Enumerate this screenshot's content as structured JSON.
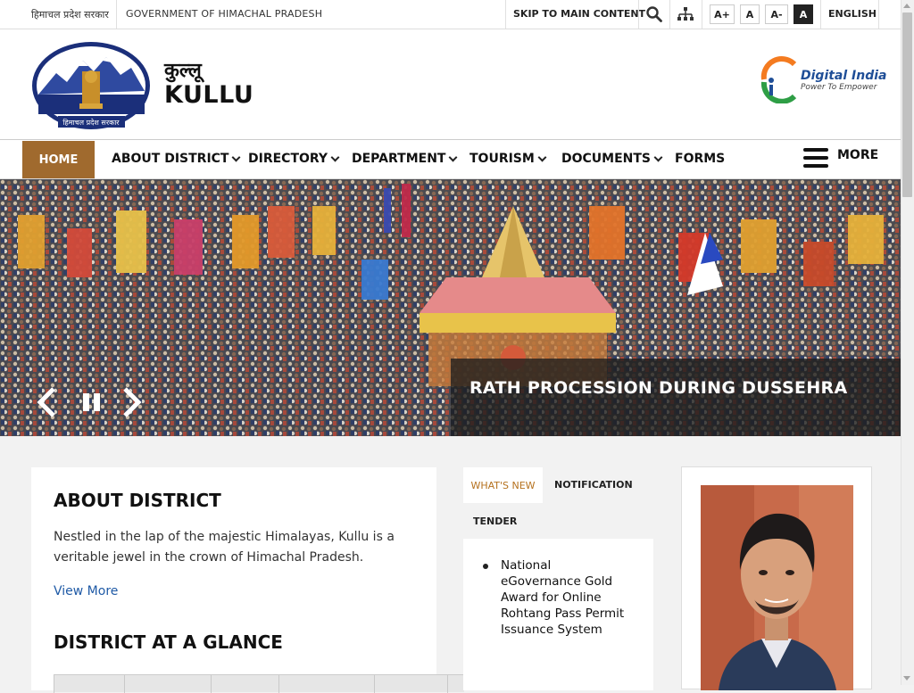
{
  "topbar": {
    "state_hindi": "हिमाचल प्रदेश सरकार",
    "government": "GOVERNMENT OF HIMACHAL PRADESH",
    "skip": "SKIP TO MAIN CONTENT",
    "font_increase": "A+",
    "font_normal": "A",
    "font_decrease": "A-",
    "contrast": "A",
    "language": "ENGLISH"
  },
  "header": {
    "title_hindi": "कुल्लू",
    "title": "KULLU",
    "logo_caption": "हिमाचल प्रदेश सरकार",
    "digital_india": "Digital India",
    "digital_india_tagline": "Power To Empower"
  },
  "nav": {
    "home": "HOME",
    "items": [
      "ABOUT DISTRICT",
      "DIRECTORY",
      "DEPARTMENT",
      "TOURISM",
      "DOCUMENTS",
      "FORMS"
    ],
    "more": "MORE"
  },
  "banner": {
    "caption": "RATH PROCESSION DURING DUSSEHRA"
  },
  "about": {
    "heading": "ABOUT DISTRICT",
    "text": "Nestled in the lap of the majestic Himalayas, Kullu is a veritable jewel in the crown of Himachal Pradesh.",
    "link": "View More",
    "glance_heading": "DISTRICT AT A GLANCE"
  },
  "tabs": {
    "whats_new": "WHAT'S NEW",
    "notification": "NOTIFICATION",
    "tender": "TENDER"
  },
  "news": {
    "items": [
      "National eGovernance Gold Award for Online Rohtang Pass Permit Issuance System"
    ]
  },
  "colors": {
    "accent": "#a06a2e",
    "link": "#1f5aa6",
    "tab_active": "#b5711e"
  }
}
